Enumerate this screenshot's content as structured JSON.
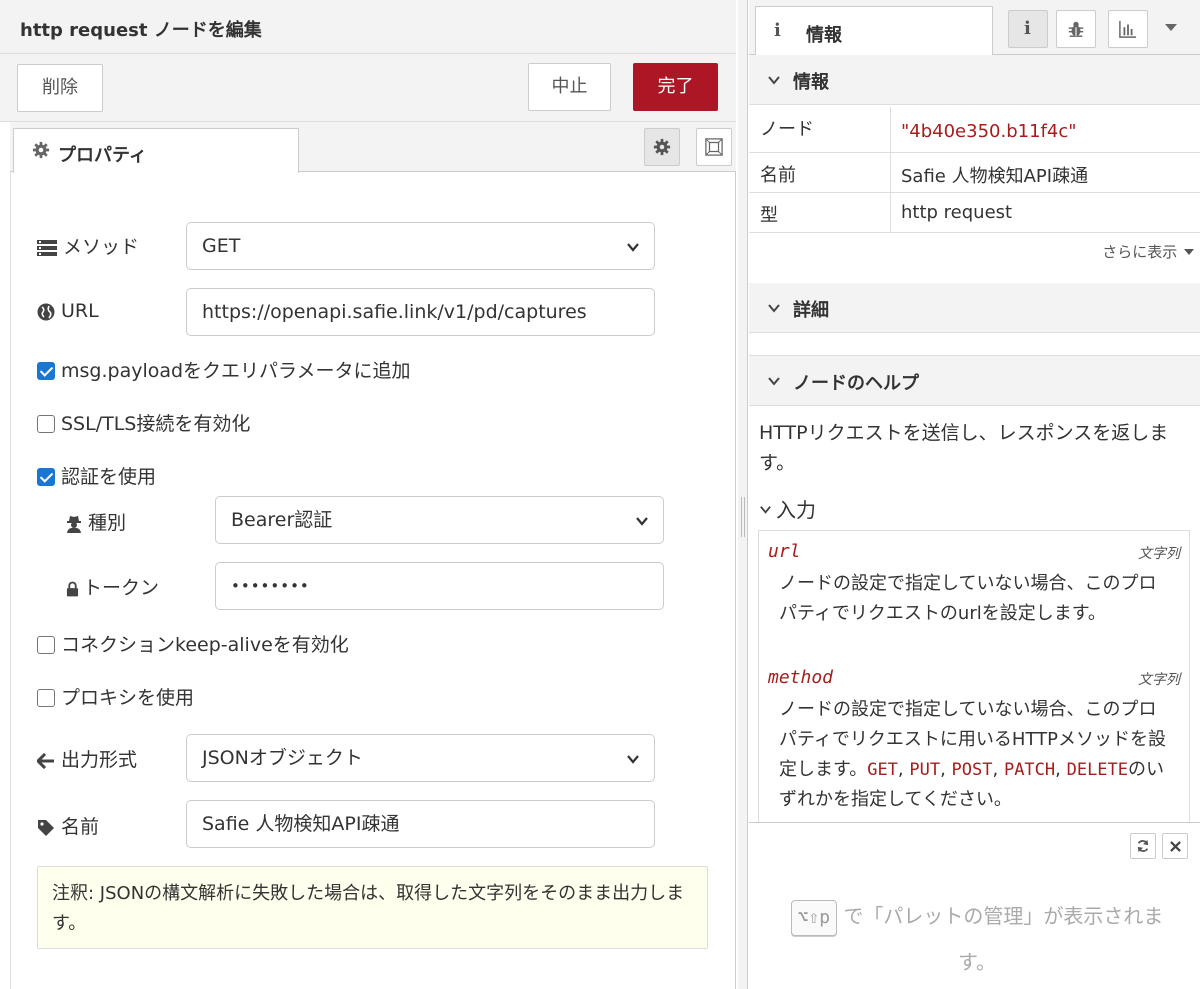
{
  "editor": {
    "title": "http request ノードを編集",
    "buttons": {
      "delete": "削除",
      "cancel": "中止",
      "done": "完了"
    },
    "tab_properties": "プロパティ",
    "fields": {
      "method_label": "メソッド",
      "method_value": "GET",
      "url_label": "URL",
      "url_value": "https://openapi.safie.link/v1/pd/captures",
      "payload_query_label": "msg.payloadをクエリパラメータに追加",
      "payload_query_checked": true,
      "ssl_label": "SSL/TLS接続を有効化",
      "ssl_checked": false,
      "auth_label": "認証を使用",
      "auth_checked": true,
      "auth_type_label": "種別",
      "auth_type_value": "Bearer認証",
      "token_label": "トークン",
      "token_value": "••••••••",
      "keepalive_label": "コネクションkeep-aliveを有効化",
      "keepalive_checked": false,
      "proxy_label": "プロキシを使用",
      "proxy_checked": false,
      "output_label": "出力形式",
      "output_value": "JSONオブジェクト",
      "name_label": "名前",
      "name_value": "Safie 人物検知API疎通"
    },
    "note": "注釈: JSONの構文解析に失敗した場合は、取得した文字列をそのまま出力します。"
  },
  "sidebar": {
    "tab_icon": "i",
    "tab_label": "情報",
    "section_info": "情報",
    "rows": [
      {
        "key": "ノード",
        "value": "\"4b40e350.b11f4c\""
      },
      {
        "key": "名前",
        "value": "Safie 人物検知API疎通"
      },
      {
        "key": "型",
        "value": "http request"
      }
    ],
    "more": "さらに表示",
    "section_detail": "詳細",
    "section_help": "ノードのヘルプ",
    "help_intro": "HTTPリクエストを送信し、レスポンスを返します。",
    "input_heading": "入力",
    "props": [
      {
        "name": "url",
        "type": "文字列",
        "desc": "ノードの設定で指定していない場合、このプロパティでリクエストのurlを設定します。"
      },
      {
        "name": "method",
        "type": "文字列",
        "desc_prefix": "ノードの設定で指定していない場合、このプロパティでリクエストに用いるHTTPメソッドを設定します。",
        "codes": [
          "GET",
          "PUT",
          "POST",
          "PATCH",
          "DELETE"
        ],
        "desc_suffix": "のいずれかを指定してください。"
      }
    ],
    "bottom_hint_key": "⌥⇧p",
    "bottom_hint_text": "で「パレットの管理」が表示されます。"
  },
  "colors": {
    "accent": "#ad1625",
    "node_id": "#a71d1d",
    "checkbox": "#1976d2",
    "note_bg": "#ffffee"
  }
}
